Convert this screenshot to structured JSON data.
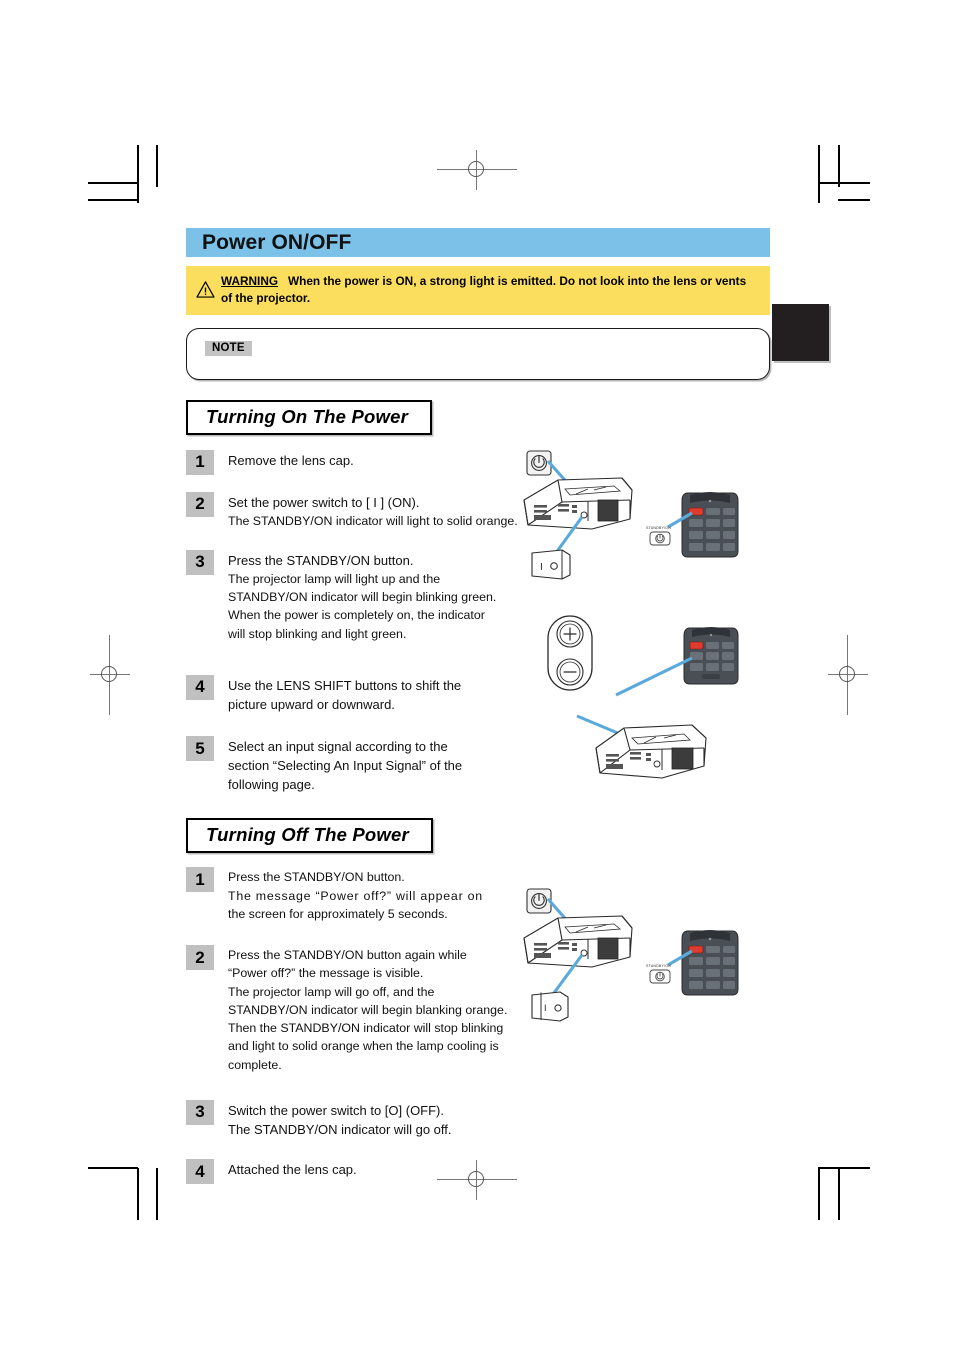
{
  "page": {
    "section_title": "Power ON/OFF",
    "accent_color": "#7cc1e8",
    "warning_color": "#fbde5e",
    "step_box_color": "#c0c0c0"
  },
  "warning": {
    "icon": "warning-triangle-icon",
    "label": "WARNING",
    "text": "When the power is ON, a strong light is emitted. Do not look into the lens or vents of the projector."
  },
  "note": {
    "tag": "NOTE",
    "body": ""
  },
  "sections": [
    {
      "heading": "Turning On The Power",
      "steps": [
        {
          "number": "1",
          "lines": [
            "Remove the lens cap."
          ]
        },
        {
          "number": "2",
          "lines": [
            "Set the power switch to [ I ] (ON).",
            "The STANDBY/ON indicator will light to solid orange."
          ]
        },
        {
          "number": "3",
          "lines": [
            "Press the STANDBY/ON button.",
            "The projector lamp will light up and the",
            "STANDBY/ON indicator will begin blinking green.",
            "When the power is completely on, the indicator",
            "will stop blinking and light green."
          ]
        },
        {
          "number": "4",
          "lines": [
            "Use the LENS SHIFT buttons to shift the",
            "picture upward or downward."
          ]
        },
        {
          "number": "5",
          "lines": [
            "Select an input signal according to the",
            "section “Selecting An Input Signal” of the",
            "following page."
          ]
        }
      ]
    },
    {
      "heading": "Turning Off The Power",
      "steps": [
        {
          "number": "1",
          "lines": [
            "Press the STANDBY/ON button.",
            "The message “Power off?” will appear on",
            "the screen for approximately 5 seconds."
          ]
        },
        {
          "number": "2",
          "lines": [
            "Press the STANDBY/ON button again while",
            "“Power off?” the message is visible.",
            "The projector lamp will go off, and the",
            "STANDBY/ON indicator will begin blanking orange.",
            "Then the STANDBY/ON indicator will stop blinking",
            "and light to solid orange when the lamp cooling is",
            "complete."
          ]
        },
        {
          "number": "3",
          "lines": [
            "Switch the power switch to [O] (OFF).",
            "The STANDBY/ON indicator will go off."
          ]
        },
        {
          "number": "4",
          "lines": [
            "Attached the lens cap."
          ]
        }
      ]
    }
  ],
  "illustrations": {
    "power_button_callout_label": "⏻",
    "remote_standby_label": "STANDBY/ON",
    "power_switch_on_mark": "I",
    "power_switch_off_mark": "O",
    "lens_shift_up_mark": "+",
    "lens_shift_down_mark": "−",
    "callout_color": "#5aa9dd"
  }
}
